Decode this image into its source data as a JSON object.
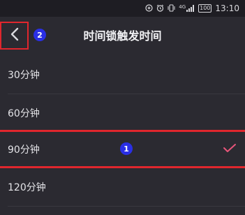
{
  "status_bar": {
    "icons": [
      "data-saver-icon",
      "alarm-icon",
      "vibrate-icon",
      "signal-icon"
    ],
    "signal_label": "4G",
    "battery": "100",
    "time": "13:10"
  },
  "header": {
    "title": "时间锁触发时间",
    "annotation_back": "2"
  },
  "options": [
    {
      "label": "30分钟",
      "selected": false
    },
    {
      "label": "60分钟",
      "selected": false
    },
    {
      "label": "90分钟",
      "selected": true
    },
    {
      "label": "120分钟",
      "selected": false
    }
  ],
  "annotation_selected": "1",
  "colors": {
    "background": "#2b2a31",
    "highlight": "#e0262d",
    "check": "#e8557a",
    "marker": "#2a2fe6"
  }
}
